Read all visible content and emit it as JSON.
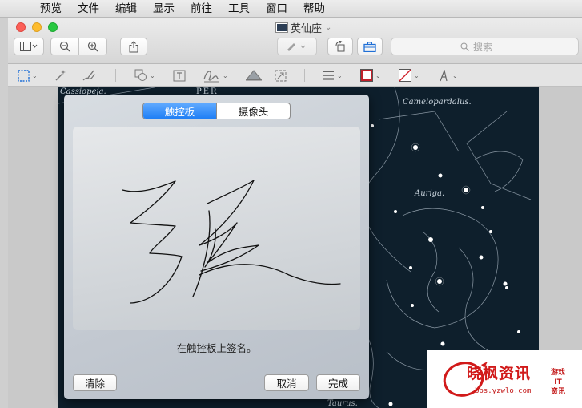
{
  "menubar": {
    "apple_glyph": "",
    "items": [
      "预览",
      "文件",
      "编辑",
      "显示",
      "前往",
      "工具",
      "窗口",
      "帮助"
    ]
  },
  "window": {
    "title": "英仙座",
    "search_placeholder": "搜索"
  },
  "toolbar_icons": [
    "sidebar-view-icon",
    "zoom-out-icon",
    "zoom-in-icon",
    "share-icon",
    "markup-pen-icon",
    "rotate-icon",
    "toolbox-icon"
  ],
  "markup_icons": [
    "rect-selection-icon",
    "instant-alpha-icon",
    "sketch-icon",
    "shapes-icon",
    "text-icon",
    "sign-icon",
    "adjust-color-icon",
    "adjust-size-icon",
    "shape-style-icon",
    "border-color-icon",
    "fill-color-icon",
    "text-style-icon"
  ],
  "starmap": {
    "labels": [
      "Cassiopeja.",
      "PER",
      "Camelopardalus.",
      "Auriga.",
      "Taurus."
    ]
  },
  "signature_sheet": {
    "tabs": [
      {
        "label": "触控板",
        "active": true
      },
      {
        "label": "摄像头",
        "active": false
      }
    ],
    "hint": "在触控板上签名。",
    "clear_label": "清除",
    "cancel_label": "取消",
    "done_label": "完成"
  },
  "watermark": {
    "main": "晓枫资讯",
    "url": "bbs.yzwlo.com",
    "side_line1": "游戏",
    "side_line2": "IT",
    "side_line3": "资讯"
  },
  "colors": {
    "accent": "#1f7ff5",
    "border_color_swatch": "#c0202a",
    "starmap_bg": "#0e1f2c",
    "watermark_red": "#d11a1a"
  }
}
